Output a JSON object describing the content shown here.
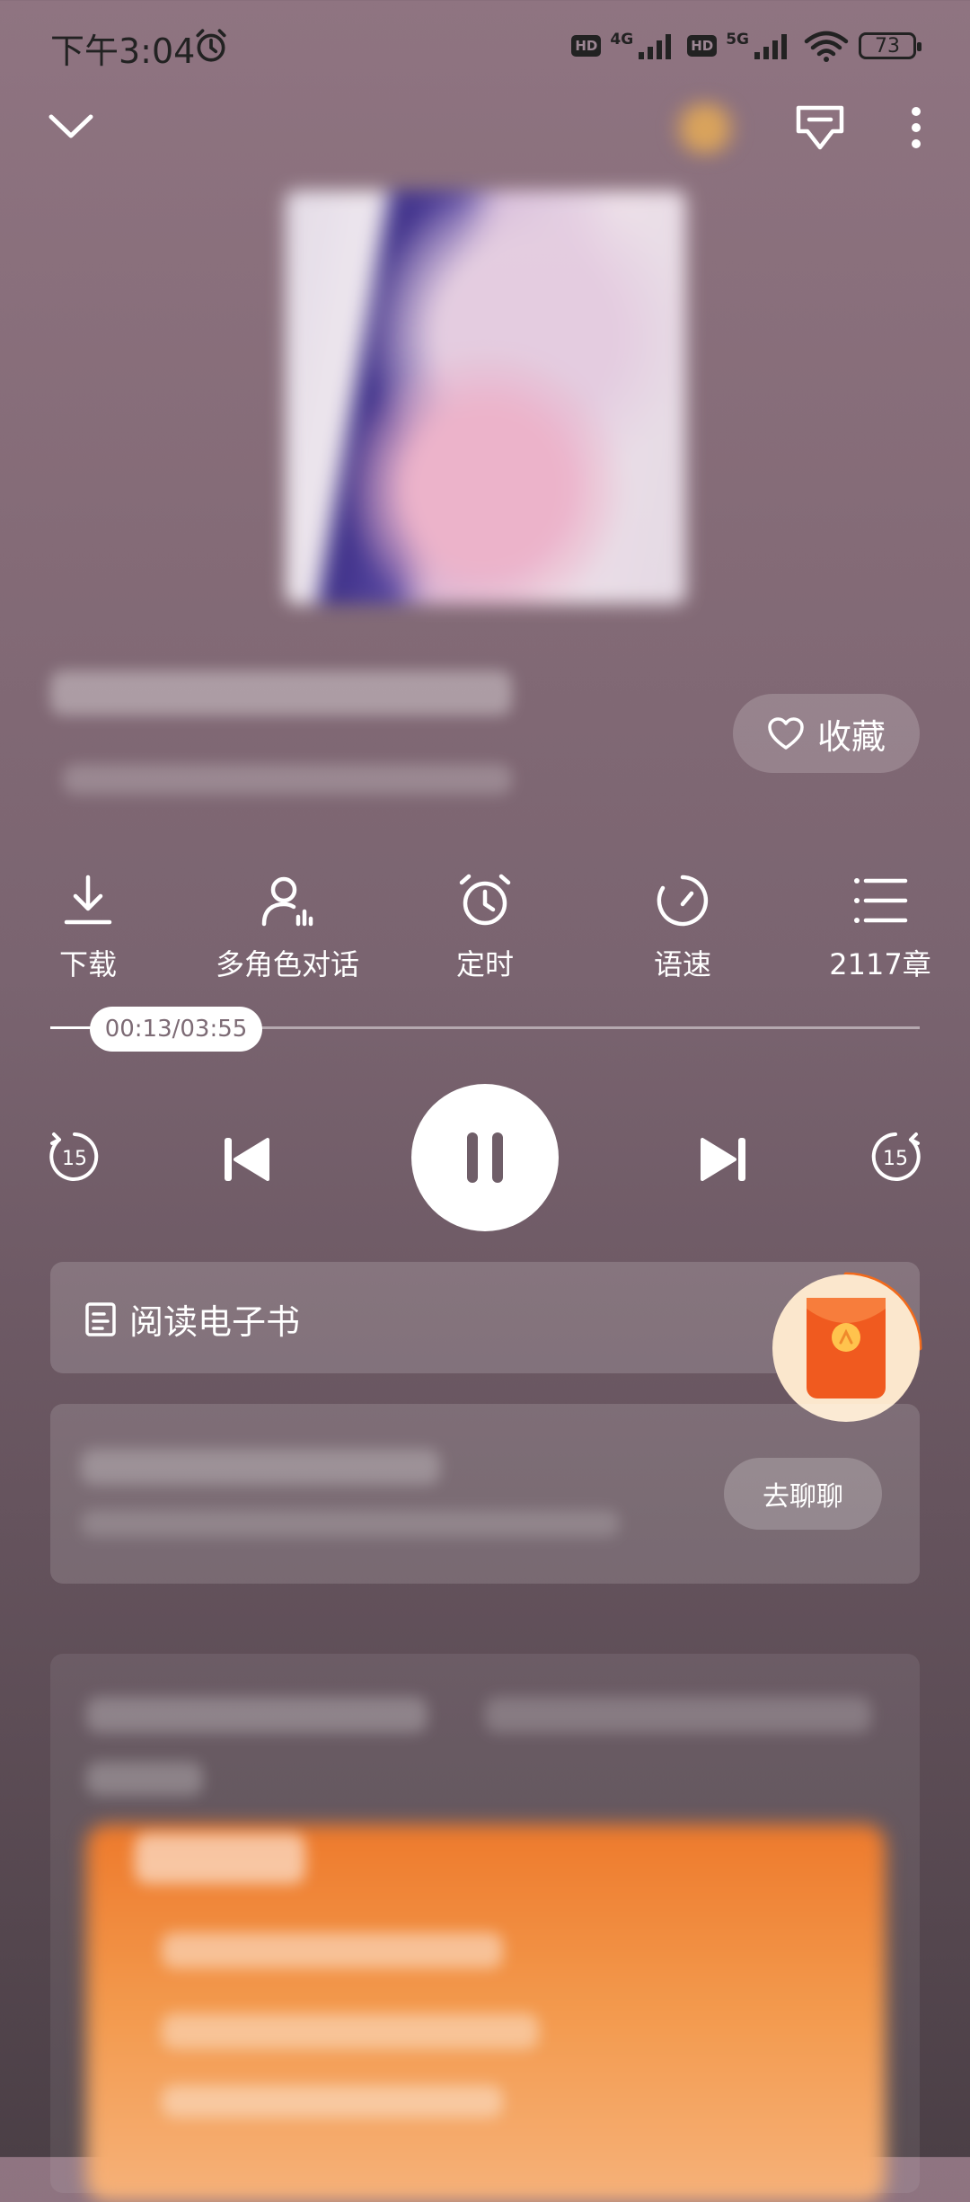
{
  "status_bar": {
    "time": "下午3:04",
    "hd1": "HD",
    "net1": "4G",
    "hd2": "HD",
    "net2": "5G",
    "battery": "73"
  },
  "player": {
    "favorite_label": "收藏",
    "progress": {
      "current_total": "00:13/03:55",
      "fraction": 0.055
    },
    "actions": [
      {
        "label": "下载",
        "icon": "download-icon"
      },
      {
        "label": "多角色对话",
        "icon": "multi-role-icon"
      },
      {
        "label": "定时",
        "icon": "alarm-clock-icon"
      },
      {
        "label": "语速",
        "icon": "speed-icon"
      },
      {
        "label": "2117章",
        "icon": "chapter-list-icon"
      }
    ],
    "rewind_seconds": "15",
    "forward_seconds": "15"
  },
  "ebook": {
    "label": "阅读电子书"
  },
  "chat": {
    "button_label": "去聊聊"
  },
  "colors": {
    "accent_orange": "#f26a1b",
    "redpack_bg": "#fbe7cd"
  }
}
